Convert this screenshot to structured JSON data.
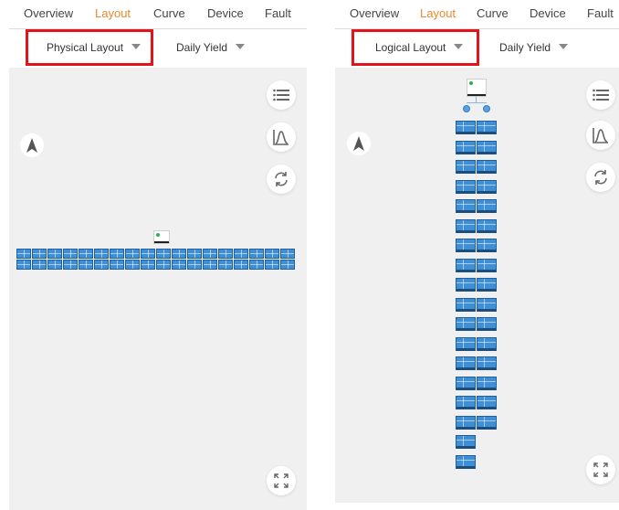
{
  "tabs": [
    "Overview",
    "Layout",
    "Curve",
    "Device",
    "Fault"
  ],
  "active_tab": "Layout",
  "left": {
    "layout_select": "Physical Layout",
    "metric_select": "Daily Yield",
    "row_count": 2,
    "panels_per_row": 18
  },
  "right": {
    "layout_select": "Logical Layout",
    "metric_select": "Daily Yield",
    "panel_rows": 18,
    "full_pair_rows": 16
  },
  "colors": {
    "active_tab": "#e8892d",
    "highlight_border": "#e2141b",
    "panel_fill": "#3f8fd6",
    "canvas_bg": "#f0f0f0"
  },
  "icons": [
    "list-icon",
    "curve-icon",
    "refresh-icon",
    "compass-icon",
    "fullscreen-icon",
    "chevron-down-icon"
  ]
}
